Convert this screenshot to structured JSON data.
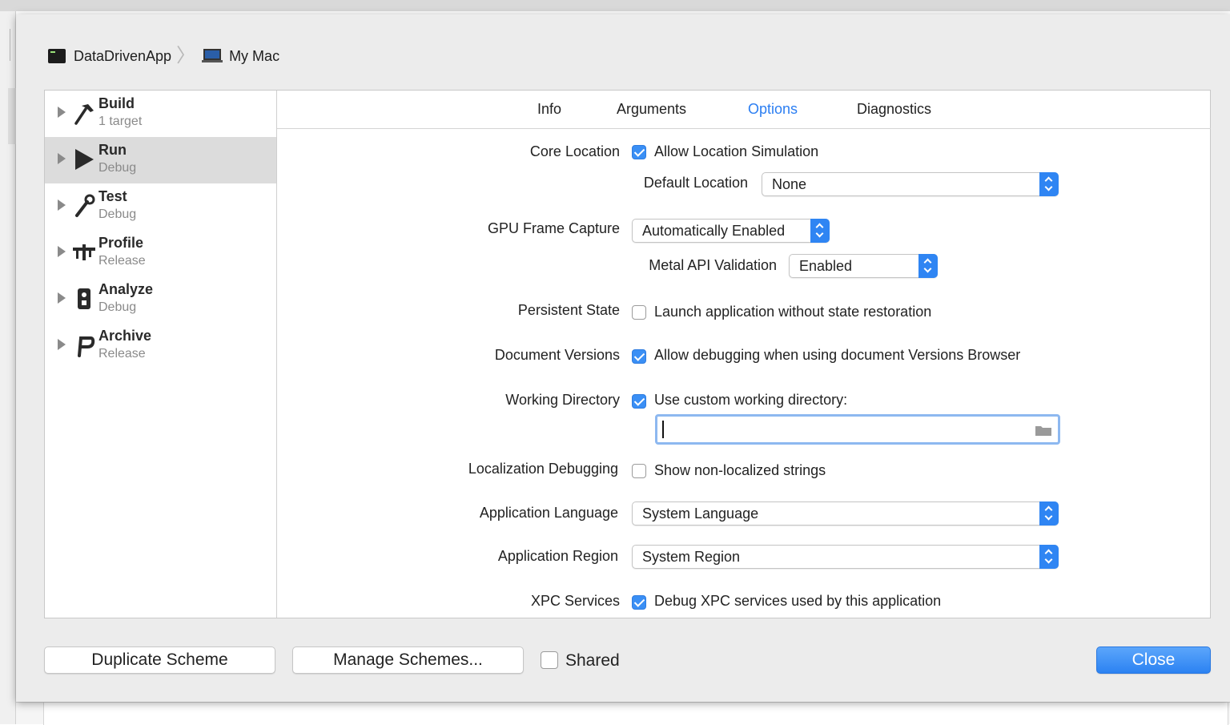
{
  "breadcrumb": {
    "scheme": "DataDrivenApp",
    "destination": "My Mac"
  },
  "sidebar": {
    "items": [
      {
        "name": "Build",
        "sub": "1 target",
        "icon": "hammer-icon",
        "selected": false
      },
      {
        "name": "Run",
        "sub": "Debug",
        "icon": "play-icon",
        "selected": true
      },
      {
        "name": "Test",
        "sub": "Debug",
        "icon": "wrench-icon",
        "selected": false
      },
      {
        "name": "Profile",
        "sub": "Release",
        "icon": "gauge-icon",
        "selected": false
      },
      {
        "name": "Analyze",
        "sub": "Debug",
        "icon": "analyze-icon",
        "selected": false
      },
      {
        "name": "Archive",
        "sub": "Release",
        "icon": "archive-icon",
        "selected": false
      }
    ]
  },
  "tabs": [
    "Info",
    "Arguments",
    "Options",
    "Diagnostics"
  ],
  "active_tab": "Options",
  "options": {
    "core_location": {
      "label": "Core Location",
      "checkbox": "Allow Location Simulation",
      "checked": true
    },
    "default_location": {
      "label": "Default Location",
      "value": "None"
    },
    "gpu_frame_capture": {
      "label": "GPU Frame Capture",
      "value": "Automatically Enabled"
    },
    "metal_api_validation": {
      "label": "Metal API Validation",
      "value": "Enabled"
    },
    "persistent_state": {
      "label": "Persistent State",
      "checkbox": "Launch application without state restoration",
      "checked": false
    },
    "document_versions": {
      "label": "Document Versions",
      "checkbox": "Allow debugging when using document Versions Browser",
      "checked": true
    },
    "working_directory": {
      "label": "Working Directory",
      "checkbox": "Use custom working directory:",
      "checked": true,
      "path": ""
    },
    "localization_debugging": {
      "label": "Localization Debugging",
      "checkbox": "Show non-localized strings",
      "checked": false
    },
    "application_language": {
      "label": "Application Language",
      "value": "System Language"
    },
    "application_region": {
      "label": "Application Region",
      "value": "System Region"
    },
    "xpc_services": {
      "label": "XPC Services",
      "checkbox": "Debug XPC services used by this application",
      "checked": true
    }
  },
  "footer": {
    "duplicate": "Duplicate Scheme",
    "manage": "Manage Schemes...",
    "shared": "Shared",
    "shared_checked": false,
    "close": "Close"
  },
  "colors": {
    "accent": "#2b7ef2",
    "sheet_bg": "#ececec"
  }
}
